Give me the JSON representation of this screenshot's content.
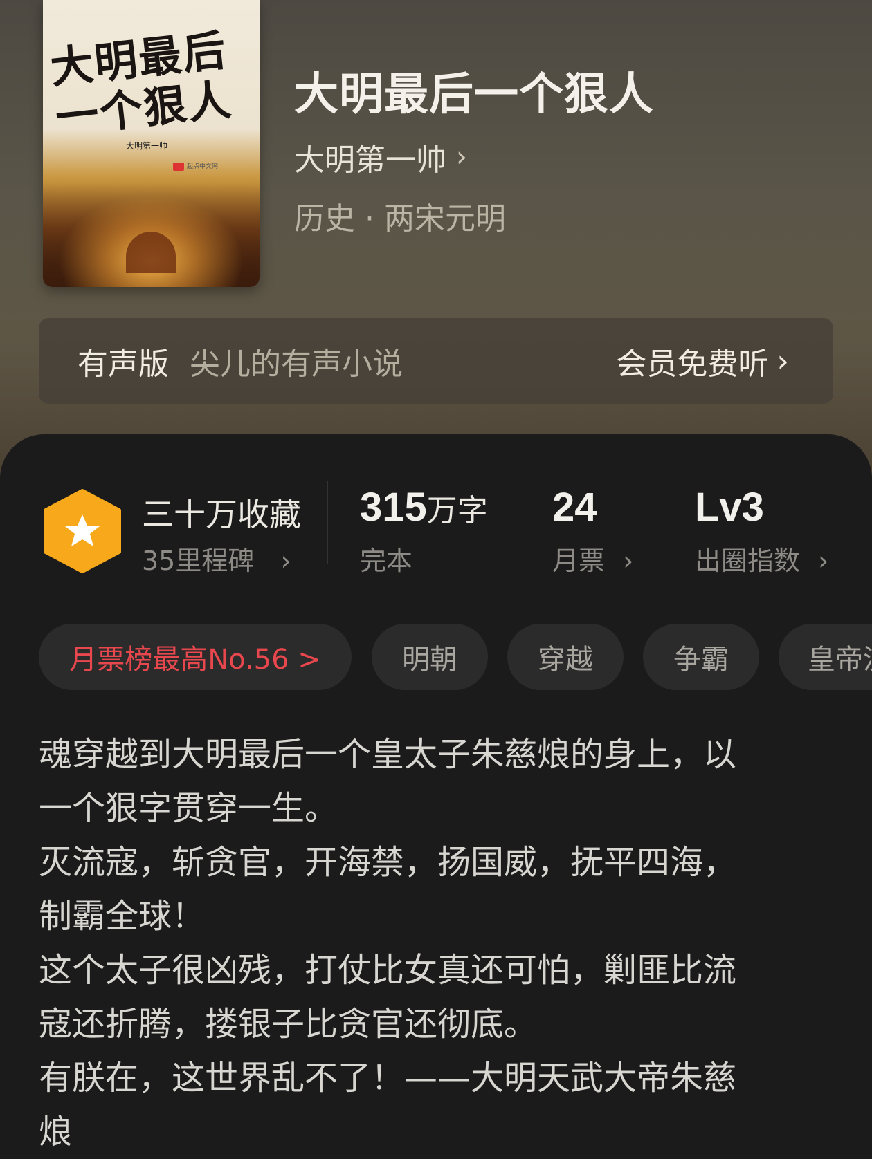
{
  "book": {
    "title": "大明最后一个狠人",
    "author": "大明第一帅",
    "author_chevron": "›",
    "genre": "历史 · 两宋元明",
    "cover": {
      "title_line1": "大明最后",
      "title_line2": "一个狠人",
      "author": "大明第一帅",
      "publisher": "起点中文网"
    }
  },
  "audio": {
    "label": "有声版",
    "narrator": "尖儿的有声小说",
    "cta": "会员免费听",
    "chevron": "›"
  },
  "stats": {
    "collect": {
      "label": "三十万收藏",
      "sub": "35里程碑",
      "chevron": "›",
      "icon": "star-hexagon-icon"
    },
    "words": {
      "number": "315",
      "unit": "万字",
      "sub": "完本"
    },
    "monthly": {
      "number": "24",
      "sub": "月票",
      "chevron": "›"
    },
    "influence": {
      "number": "Lv3",
      "sub": "出圈指数",
      "chevron": "›"
    }
  },
  "tags": [
    {
      "label": "月票榜最高No.56 >"
    },
    {
      "label": "明朝"
    },
    {
      "label": "穿越"
    },
    {
      "label": "争霸"
    },
    {
      "label": "皇帝流"
    }
  ],
  "description": [
    "魂穿越到大明最后一个皇太子朱慈烺的身上，以",
    "一个狠字贯穿一生。",
    "灭流寇，斩贪官，开海禁，扬国威，抚平四海，",
    "制霸全球！",
    "这个太子很凶残，打仗比女真还可怕，剿匪比流",
    "寇还折腾，搂银子比贪官还彻底。",
    "有朕在，这世界乱不了！——大明天武大帝朱慈",
    "烺"
  ],
  "colors": {
    "accent_red": "#e8474d",
    "badge_orange": "#f7a81b",
    "panel_bg": "#1b1b1b"
  }
}
